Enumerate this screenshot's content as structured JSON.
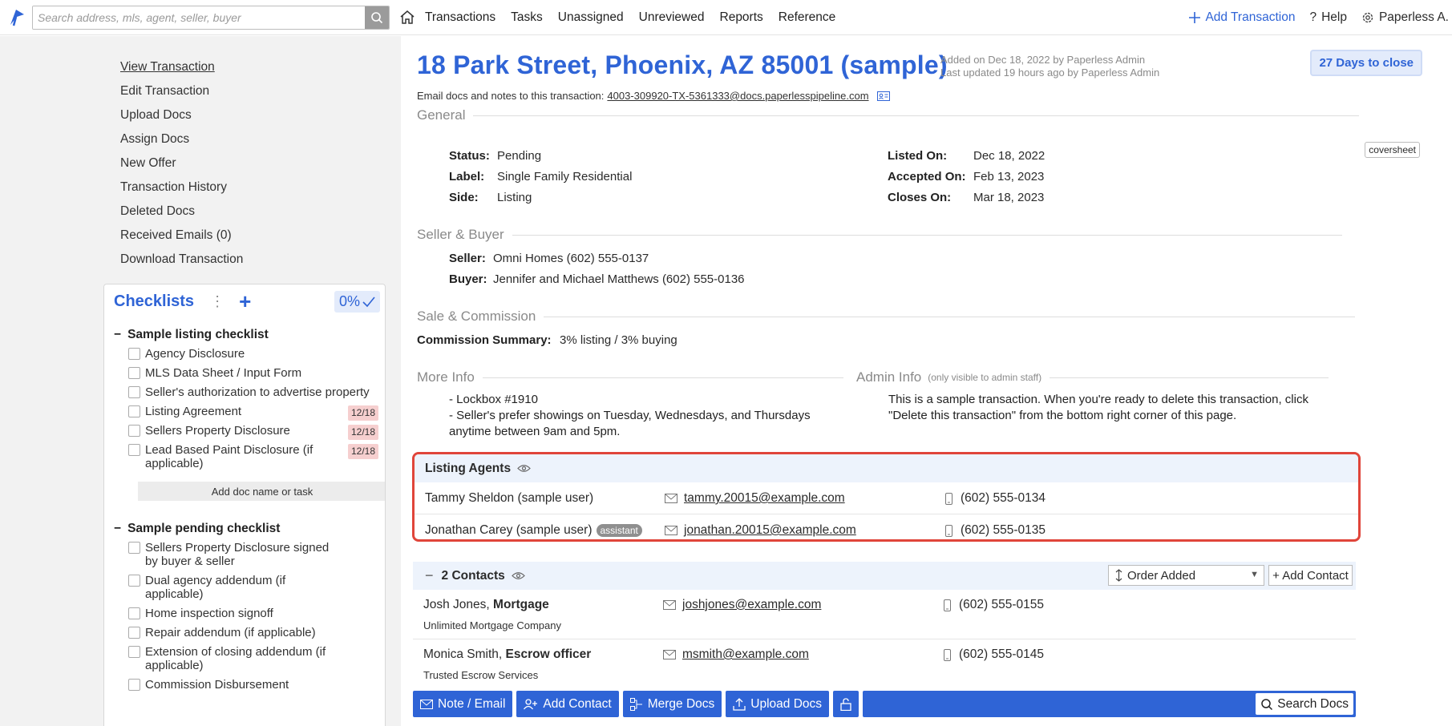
{
  "nav": {
    "search_placeholder": "Search address, mls, agent, seller, buyer",
    "links": [
      "Transactions",
      "Tasks",
      "Unassigned",
      "Unreviewed",
      "Reports",
      "Reference"
    ],
    "add_transaction": "Add Transaction",
    "help": "Help",
    "user": "Paperless A.",
    "accent_color": "#2f64d6"
  },
  "sidebar": {
    "links": [
      {
        "label": "View Transaction"
      },
      {
        "label": "Edit Transaction"
      },
      {
        "label": "Upload Docs"
      },
      {
        "label": "Assign Docs"
      },
      {
        "label": "New Offer"
      },
      {
        "label": "Transaction History"
      },
      {
        "label": "Deleted Docs"
      },
      {
        "label": "Received Emails (0)"
      },
      {
        "label": "Download Transaction"
      }
    ]
  },
  "checklists": {
    "title": "Checklists",
    "percent": "0%",
    "add_doc_label": "Add doc name or task",
    "groups": [
      {
        "title": "Sample listing checklist",
        "items": [
          {
            "label": "Agency Disclosure",
            "date": ""
          },
          {
            "label": "MLS Data Sheet / Input Form",
            "date": ""
          },
          {
            "label": "Seller's authorization to advertise property",
            "date": ""
          },
          {
            "label": "Listing Agreement",
            "date": "12/18"
          },
          {
            "label": "Sellers Property Disclosure",
            "date": "12/18"
          },
          {
            "label": "Lead Based Paint Disclosure (if applicable)",
            "date": "12/18"
          }
        ]
      },
      {
        "title": "Sample pending checklist",
        "items": [
          {
            "label": "Sellers Property Disclosure signed by buyer & seller",
            "date": ""
          },
          {
            "label": "Dual agency addendum (if applicable)",
            "date": ""
          },
          {
            "label": "Home inspection signoff",
            "date": ""
          },
          {
            "label": "Repair addendum (if applicable)",
            "date": ""
          },
          {
            "label": "Extension of closing addendum (if applicable)",
            "date": ""
          },
          {
            "label": "Commission Disbursement",
            "date": ""
          }
        ]
      }
    ]
  },
  "transaction": {
    "title": "18 Park Street, Phoenix, AZ 85001 (sample)",
    "added": "Added on Dec 18, 2022 by Paperless Admin",
    "updated": "Last updated 19 hours ago by Paperless Admin",
    "days_to_close": "27 Days to close",
    "email_prefix": "Email docs and notes to this transaction:",
    "email_address": "4003-309920-TX-5361333@docs.paperlesspipeline.com",
    "coversheet": "coversheet"
  },
  "general": {
    "heading": "General",
    "status_label": "Status:",
    "status": "Pending",
    "label_label": "Label:",
    "label": "Single Family Residential",
    "side_label": "Side:",
    "side": "Listing",
    "listed_label": "Listed On:",
    "listed": "Dec 18, 2022",
    "accepted_label": "Accepted On:",
    "accepted": "Feb 13, 2023",
    "closes_label": "Closes On:",
    "closes": "Mar 18, 2023"
  },
  "seller_buyer": {
    "heading": "Seller & Buyer",
    "seller_label": "Seller:",
    "seller": "Omni Homes (602) 555-0137",
    "buyer_label": "Buyer:",
    "buyer": "Jennifer and Michael Matthews (602) 555-0136"
  },
  "commission": {
    "heading": "Sale & Commission",
    "summary_label": "Commission Summary:",
    "summary": "3% listing / 3% buying"
  },
  "more_info": {
    "heading": "More Info",
    "line1": "- Lockbox #1910",
    "line2": "- Seller's prefer showings on Tuesday, Wednesdays, and Thursdays",
    "line3": "anytime between 9am and 5pm."
  },
  "admin_info": {
    "heading": "Admin Info",
    "note": "(only visible to admin staff)",
    "text": "This is a sample transaction. When you're ready to delete this transaction, click \"Delete this transaction\" from the bottom right corner of this page."
  },
  "listing_agents": {
    "heading": "Listing Agents",
    "highlight_color": "#e0453a",
    "agents": [
      {
        "name": "Tammy Sheldon (sample user)",
        "badge": "",
        "email": "tammy.20015@example.com",
        "phone": "(602) 555-0134"
      },
      {
        "name": "Jonathan Carey (sample user)",
        "badge": "assistant",
        "email": "jonathan.20015@example.com",
        "phone": "(602) 555-0135"
      }
    ]
  },
  "contacts": {
    "heading": "2 Contacts",
    "order_label": "Order Added",
    "add_label": "+ Add Contact",
    "list": [
      {
        "name": "Josh Jones,",
        "role": "Mortgage",
        "company": "Unlimited Mortgage Company",
        "email": "joshjones@example.com",
        "phone": "(602) 555-0155"
      },
      {
        "name": "Monica Smith,",
        "role": "Escrow officer",
        "company": "Trusted Escrow Services",
        "email": "msmith@example.com",
        "phone": "(602) 555-0145"
      }
    ]
  },
  "bottom_bar": {
    "note_email": "Note / Email",
    "add_contact": "Add Contact",
    "merge_docs": "Merge Docs",
    "upload_docs": "Upload Docs",
    "search_docs": "Search Docs"
  }
}
